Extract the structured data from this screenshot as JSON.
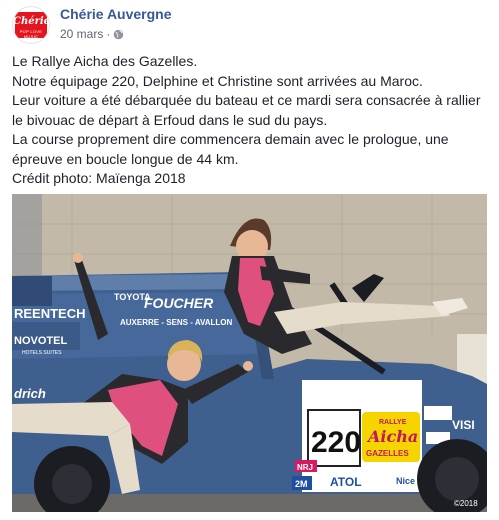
{
  "page": {
    "name": "Chérie Auvergne",
    "logo_text": "Chérie",
    "logo_sub": "POP LOVE MUSIC"
  },
  "post": {
    "date": "20 mars",
    "separator": "·",
    "privacy_icon": "globe-icon",
    "lines": [
      "Le Rallye Aicha des Gazelles.",
      "Notre équipage 220, Delphine et Christine sont arrivées au Maroc.",
      "Leur voiture a été débarquée du bateau et ce mardi sera consacrée à rallier",
      "le bivouac de départ à Erfoud dans le sud du pays.",
      "La course proprement dire commencera demain avec le prologue, une",
      "épreuve en boucle longue de 44 km.",
      "Crédit photo: Maïenga 2018"
    ]
  },
  "photo": {
    "sponsor_toyota": "TOYOTA",
    "sponsor_foucher": "FOUCHER",
    "sponsor_foucher_sub": "AUXERRE - SENS - AVALLON",
    "sponsor_novotel": "NOVOTEL",
    "sponsor_reentech": "REENTECH",
    "sponsor_hotel": "HOTELS SUITES",
    "sponsor_drich": "drich",
    "sponsor_vis": "VISI",
    "car_number": "220",
    "rally_line1": "RALLYE",
    "rally_line2": "Aicha",
    "rally_line3": "GAZELLES",
    "sponsor_atol": "ATOL",
    "sponsor_nice": "Nice",
    "sponsor_2m": "2M",
    "sponsor_nrj": "NRJ",
    "watermark": "©2018",
    "colors": {
      "car_blue": "#3f5f8e",
      "pink_jacket": "#e0507e",
      "wall": "#c9bfae"
    }
  }
}
